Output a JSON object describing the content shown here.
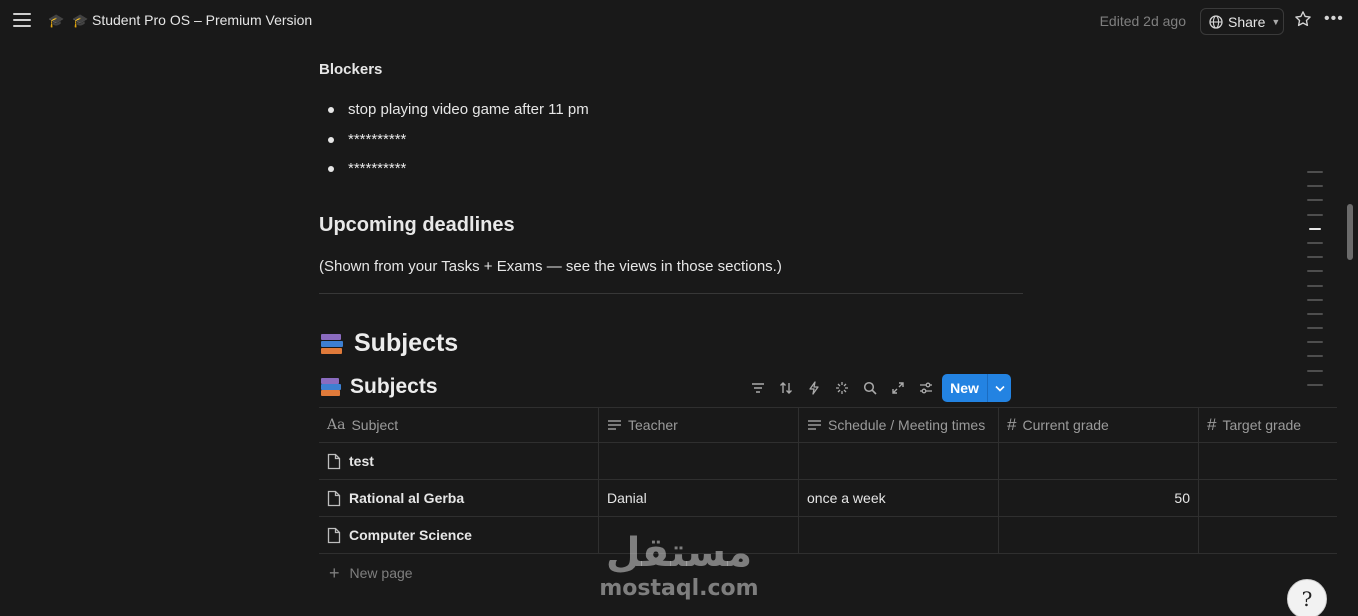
{
  "topbar": {
    "title": "Student Pro OS – Premium Version",
    "edited": "Edited 2d ago",
    "share_label": "Share"
  },
  "blockers": {
    "heading": "Blockers",
    "items": [
      "stop playing video game after 11 pm",
      "**********",
      "**********"
    ]
  },
  "deadlines": {
    "heading": "Upcoming deadlines",
    "text": "(Shown from your Tasks + Exams — see the views in those sections.)"
  },
  "subjects_heading": "Subjects",
  "database": {
    "title": "Subjects",
    "new_label": "New",
    "columns": [
      "Subject",
      "Teacher",
      "Schedule / Meeting times",
      "Current grade",
      "Target grade"
    ],
    "rows": [
      {
        "subject": "test",
        "teacher": "",
        "schedule": "",
        "current_grade": "",
        "target_grade": ""
      },
      {
        "subject": "Rational al Gerba",
        "teacher": "Danial",
        "schedule": "once a week",
        "current_grade": "50",
        "target_grade": ""
      },
      {
        "subject": "Computer Science",
        "teacher": "",
        "schedule": "",
        "current_grade": "",
        "target_grade": ""
      }
    ],
    "new_page_label": "New page"
  },
  "watermark": {
    "arabic": "مستقل",
    "latin": "mostaql.com"
  },
  "colors": {
    "background": "#191919",
    "accent": "#2383e2"
  }
}
